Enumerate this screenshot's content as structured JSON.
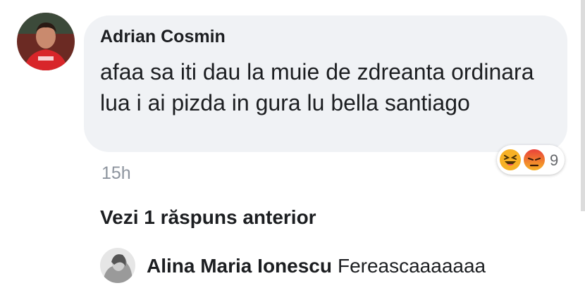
{
  "comment": {
    "author": "Adrian Cosmin",
    "text": "afaa sa iti dau la muie de zdreanta ordinara lua i ai pizda in gura lu bella santiago",
    "time": "15h",
    "reactions": {
      "icons": [
        "haha-icon",
        "angry-icon"
      ],
      "count": "9"
    }
  },
  "replies": {
    "view_previous_label": "Vezi 1 răspuns anterior",
    "items": [
      {
        "author": "Alina Maria Ionescu",
        "text": "Fereascaaaaaaa"
      }
    ]
  },
  "colors": {
    "bubble": "#f0f2f5",
    "text": "#1c1e21",
    "muted": "#8d949e",
    "reaction_yellow": "#f7b125",
    "reaction_red": "#e9710f"
  }
}
